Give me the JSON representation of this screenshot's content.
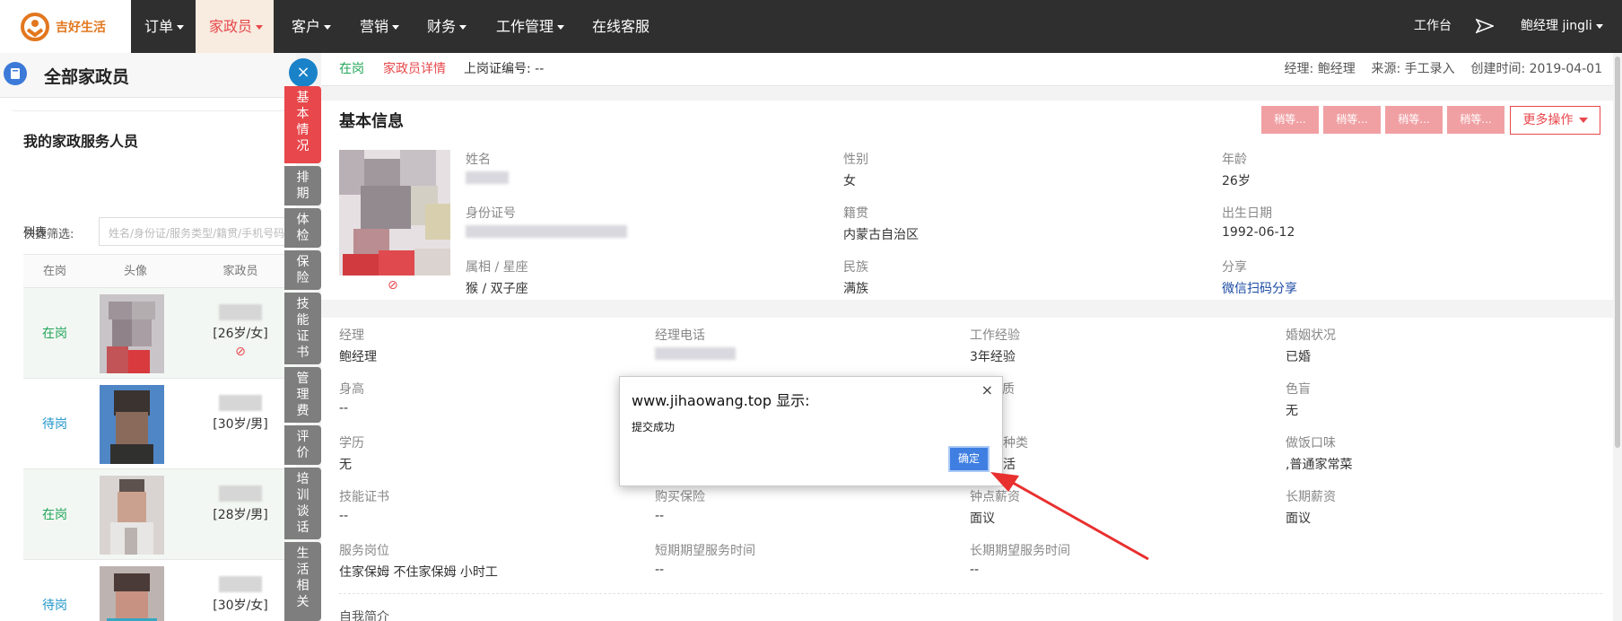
{
  "nav": {
    "brand": "吉好生活",
    "items": [
      "订单",
      "家政员",
      "客户",
      "营销",
      "财务",
      "工作管理",
      "在线客服"
    ],
    "workbench": "工作台",
    "user": "鲍经理  jingli"
  },
  "left_panel": {
    "title": "全部家政员",
    "subtitle": "我的家政服务人员",
    "filter_label": "快捷筛选:",
    "filter_placeholder": "姓名/身份证/服务类型/籍贯/手机号码",
    "list_label": "列表",
    "columns": [
      "在岗",
      "头像",
      "家政员"
    ],
    "rows": [
      {
        "status": "在岗",
        "info": "[26岁/女]"
      },
      {
        "status": "待岗",
        "info": "[30岁/男]"
      },
      {
        "status": "在岗",
        "info": "[28岁/男]"
      },
      {
        "status": "待岗",
        "info": "[30岁/女]"
      }
    ]
  },
  "side_tabs": [
    "基本情况",
    "排期",
    "体检",
    "保险",
    "技能证书",
    "管理费",
    "评价",
    "培训谈话",
    "生活相关"
  ],
  "detail_bar": {
    "status": "在岗",
    "link": "家政员详情",
    "cert": "上岗证编号: --",
    "meta": "经理: 鲍经理    来源: 手工录入    创建时间: 2019-04-01"
  },
  "basic_info": {
    "title": "基本信息",
    "loading_buttons": [
      "稍等...",
      "稍等...",
      "稍等...",
      "稍等..."
    ],
    "more_button": "更多操作",
    "top_fields": [
      {
        "label": "姓名",
        "value": ""
      },
      {
        "label": "性别",
        "value": "女"
      },
      {
        "label": "年龄",
        "value": "26岁"
      },
      {
        "label": "身份证号",
        "value": ""
      },
      {
        "label": "籍贯",
        "value": "内蒙古自治区"
      },
      {
        "label": "出生日期",
        "value": "1992-06-12"
      },
      {
        "label": "属相 / 星座",
        "value": "猴 / 双子座"
      },
      {
        "label": "民族",
        "value": "满族"
      },
      {
        "label": "分享",
        "value": "微信扫码分享"
      }
    ],
    "grid_fields": [
      {
        "label": "经理",
        "value": "鲍经理"
      },
      {
        "label": "经理电话",
        "value": ""
      },
      {
        "label": "工作经验",
        "value": "3年经验"
      },
      {
        "label": "婚姻状况",
        "value": "已婚"
      },
      {
        "label": "身高",
        "value": "--"
      },
      {
        "label": "",
        "value": ""
      },
      {
        "label": "体质",
        "value": ""
      },
      {
        "label": "色盲",
        "value": "无"
      },
      {
        "label": "学历",
        "value": "无"
      },
      {
        "label": "",
        "value": ""
      },
      {
        "label": "种类",
        "value": "活"
      },
      {
        "label": "做饭口味",
        "value": ",普通家常菜"
      },
      {
        "label": "技能证书",
        "value": "--"
      },
      {
        "label": "购买保险",
        "value": "--"
      },
      {
        "label": "钟点薪资",
        "value": "面议"
      },
      {
        "label": "长期薪资",
        "value": "面议"
      },
      {
        "label": "服务岗位",
        "value": "住家保姆 不住家保姆 小时工"
      },
      {
        "label": "短期期望服务时间",
        "value": "--"
      },
      {
        "label": "长期期望服务时间",
        "value": "--"
      },
      {
        "label": "",
        "value": ""
      }
    ],
    "self_intro_label": "自我简介"
  },
  "dialog": {
    "title": "www.jihaowang.top 显示:",
    "message": "提交成功",
    "ok_label": "确定",
    "close": "×"
  },
  "colors": {
    "brand_orange": "#e2771f",
    "active_red": "#e8474b",
    "status_green": "#21a558",
    "status_blue": "#1f95c8",
    "link_blue": "#1c4aa3",
    "arrow_red": "#e8302f"
  },
  "icons": {
    "close_tab": "close-circle-icon",
    "ban": "ban-icon",
    "book": "book-icon",
    "send": "send-icon"
  }
}
